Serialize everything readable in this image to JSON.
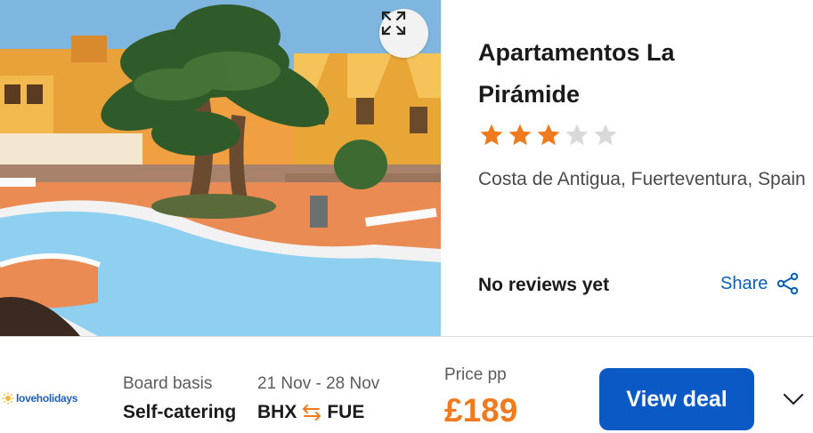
{
  "hotel": {
    "name": "Apartamentos La Pirámide",
    "rating_stars": 3,
    "max_stars": 5,
    "location": "Costa de Antigua, Fuerteventura, Spain",
    "reviews_text": "No reviews yet",
    "share_label": "Share"
  },
  "photo": {
    "expand_icon": "expand-icon"
  },
  "deal": {
    "provider_logo_text": "loveholidays",
    "board_basis_label": "Board basis",
    "board_basis_value": "Self-catering",
    "dates": "21 Nov - 28 Nov",
    "route_from": "BHX",
    "route_to": "FUE",
    "price_label": "Price pp",
    "price": "£189",
    "cta_label": "View deal",
    "expand_icon": "chevron-down-icon"
  },
  "colors": {
    "accent_blue": "#0b59c4",
    "star_filled": "#f07b1e",
    "star_empty": "#d9d9d9",
    "price": "#f07b1e",
    "link": "#0b5fb3"
  }
}
